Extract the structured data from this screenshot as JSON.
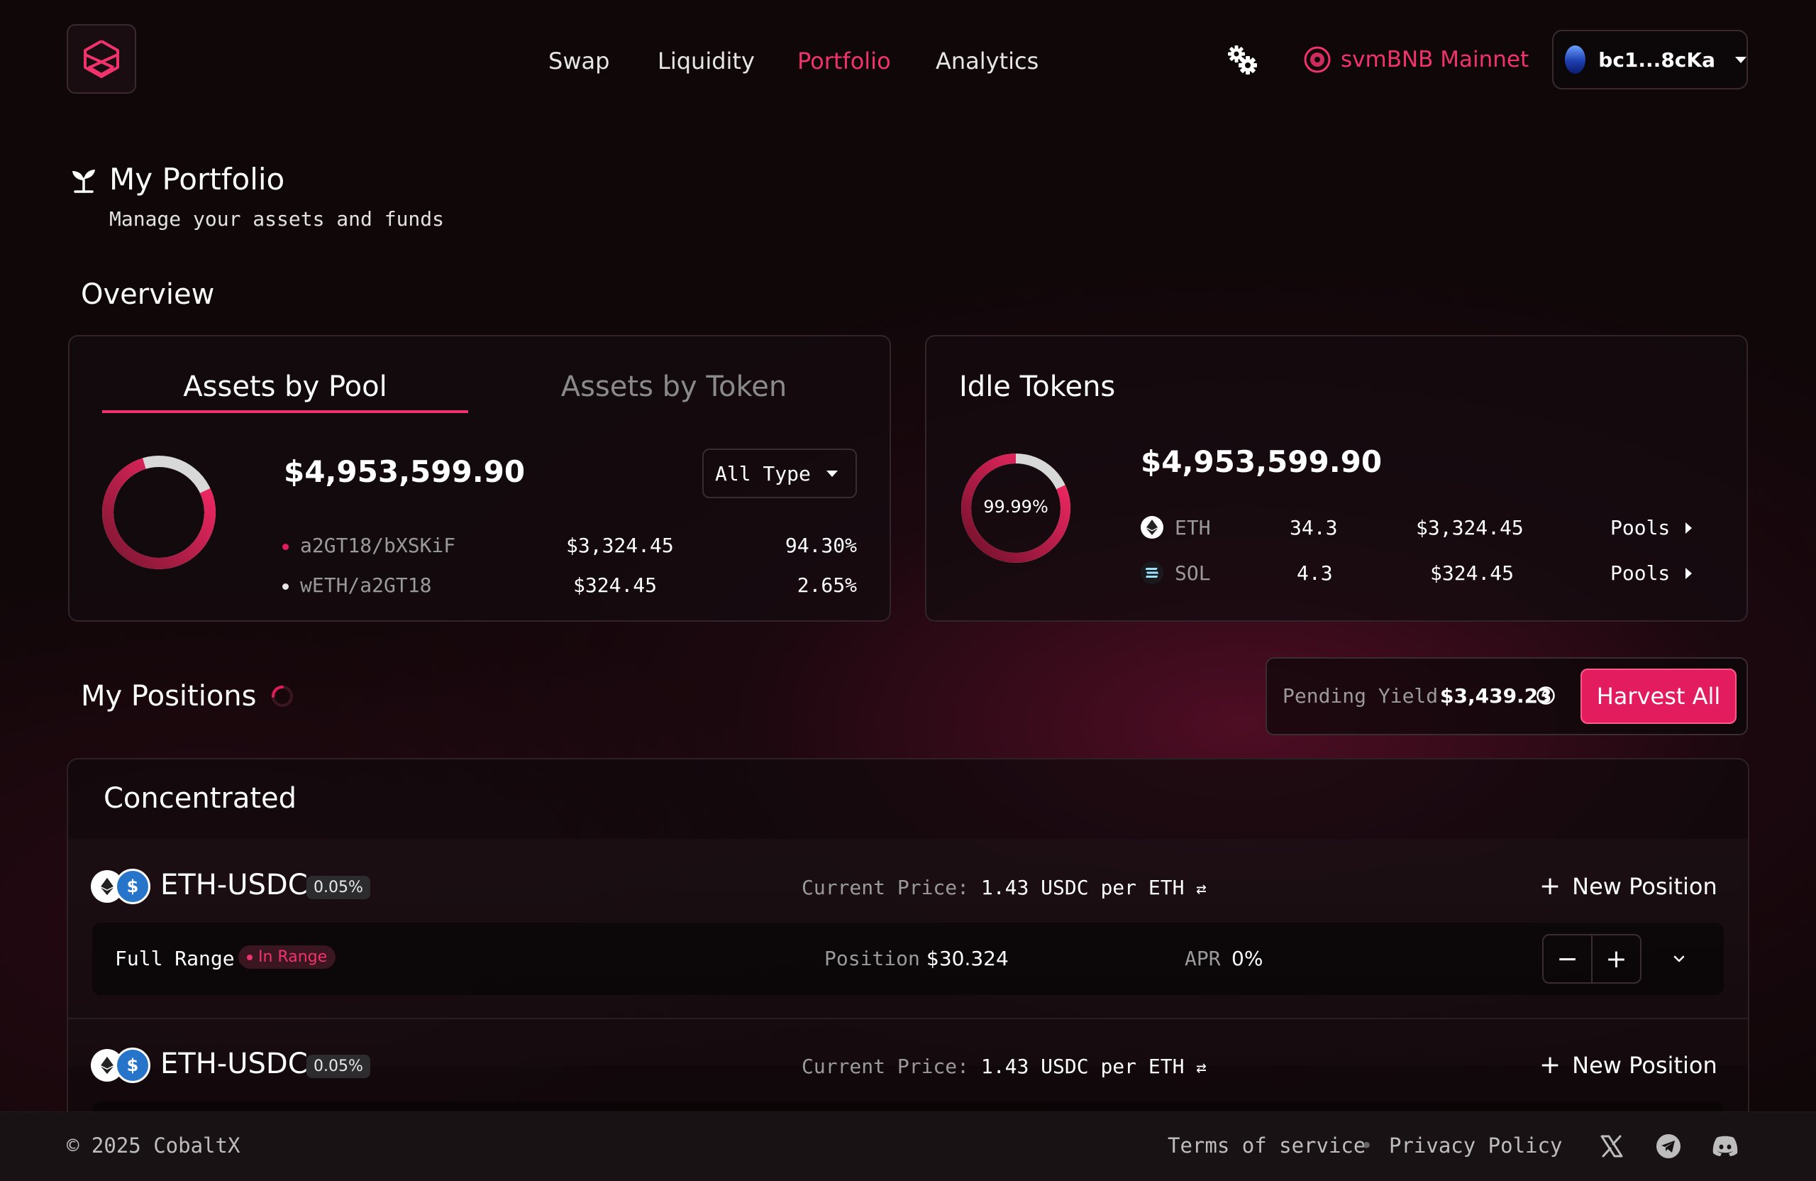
{
  "nav": {
    "items": [
      {
        "label": "Swap",
        "active": false
      },
      {
        "label": "Liquidity",
        "active": false
      },
      {
        "label": "Portfolio",
        "active": true
      },
      {
        "label": "Analytics",
        "active": false
      }
    ],
    "network": "svmBNB Mainnet",
    "wallet": "bc1...8cKa"
  },
  "header": {
    "title": "My Portfolio",
    "subtitle": "Manage your assets and funds",
    "overview_label": "Overview"
  },
  "assets_card": {
    "tabs": [
      {
        "label": "Assets by Pool",
        "active": true
      },
      {
        "label": "Assets by Token",
        "active": false
      }
    ],
    "total": "$4,953,599.90",
    "filter": "All Type",
    "rows": [
      {
        "name": "a2GT18/bXSKiF",
        "value": "$3,324.45",
        "percent": "94.30%",
        "share": 0.943,
        "color": "#e21c5f"
      },
      {
        "name": "wETH/a2GT18",
        "value": "$324.45",
        "percent": "2.65%",
        "share": 0.0265,
        "color": "#e6e6e6"
      }
    ]
  },
  "idle_card": {
    "title": "Idle Tokens",
    "donut_label": "99.99%",
    "donut_share": 0.9999,
    "total": "$4,953,599.90",
    "rows": [
      {
        "symbol": "ETH",
        "amount": "34.3",
        "value": "$3,324.45",
        "link": "Pools",
        "icon": "eth-icon"
      },
      {
        "symbol": "SOL",
        "amount": "4.3",
        "value": "$324.45",
        "link": "Pools",
        "icon": "sol-icon"
      }
    ]
  },
  "positions": {
    "title": "My Positions",
    "pending_label": "Pending Yield",
    "pending_value": "$3,439.23",
    "harvest_label": "Harvest All",
    "section_title": "Concentrated",
    "pools": [
      {
        "pair": "ETH-USDC",
        "fee": "0.05%",
        "price_label": "Current Price:",
        "price": "1.43 USDC per ETH",
        "new_label": "New Position",
        "range": "Full Range",
        "status": "In Range",
        "position_label": "Position",
        "position_value": "$30.324",
        "apr_label": "APR",
        "apr_value": "0%"
      },
      {
        "pair": "ETH-USDC",
        "fee": "0.05%",
        "price_label": "Current Price:",
        "price": "1.43 USDC per ETH",
        "new_label": "New Position"
      }
    ]
  },
  "footer": {
    "copyright": "© 2025 CobaltX",
    "terms": "Terms of service",
    "separator": "•",
    "privacy": "Privacy Policy",
    "socials": [
      "x-icon",
      "telegram-icon",
      "discord-icon"
    ]
  },
  "colors": {
    "accent": "#f0336d",
    "button": "#e21c5f",
    "background": "#100709"
  }
}
